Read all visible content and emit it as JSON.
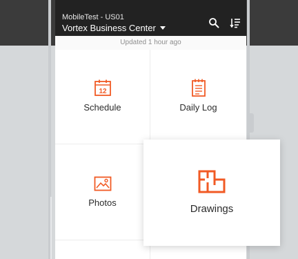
{
  "header": {
    "subtitle": "MobileTest - US01",
    "title": "Vortex Business Center"
  },
  "status": {
    "updated": "Updated 1 hour ago"
  },
  "tiles": {
    "schedule": {
      "label": "Schedule",
      "icon": "calendar-icon",
      "day": "12"
    },
    "daily_log": {
      "label": "Daily Log",
      "icon": "notebook-icon"
    },
    "photos": {
      "label": "Photos",
      "icon": "photo-icon"
    },
    "drawings": {
      "label": "Drawings",
      "icon": "floorplan-icon"
    }
  },
  "colors": {
    "accent": "#f15a24",
    "header_bg": "#222222",
    "background_top": "#3b3b3b",
    "background": "#d5d8da"
  }
}
